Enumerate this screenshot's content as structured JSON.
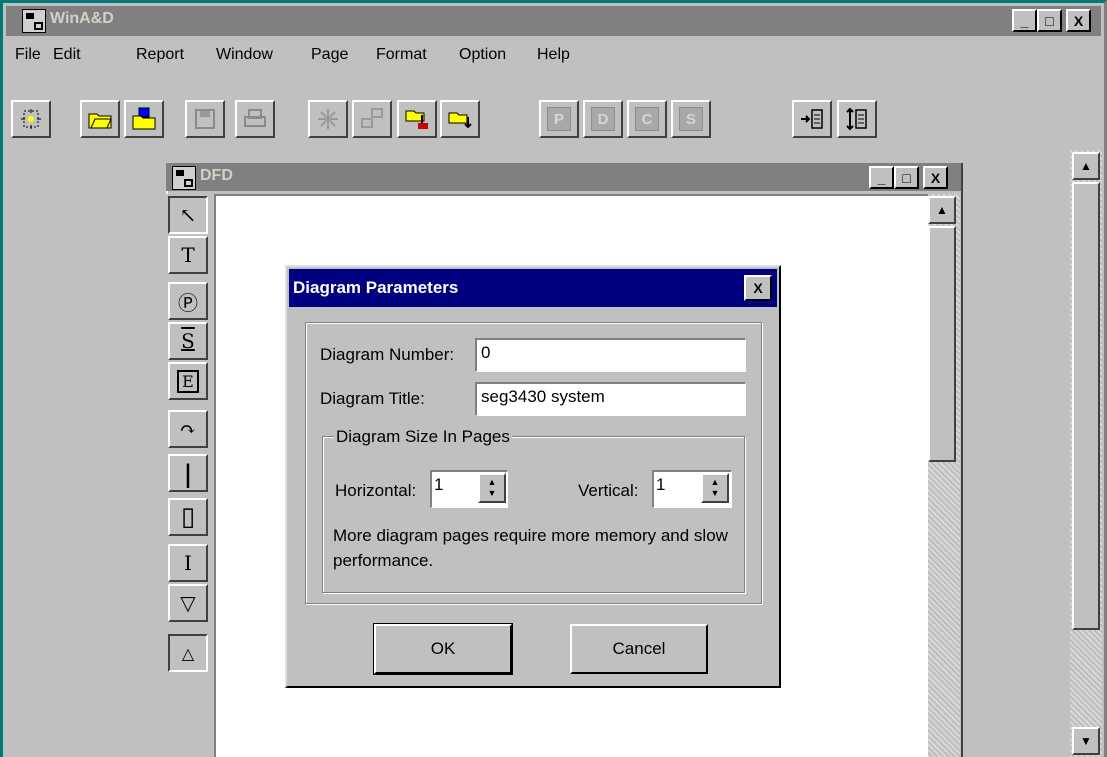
{
  "app": {
    "title": "WinA&D",
    "window_controls": {
      "minimize": "_",
      "maximize": "□",
      "close": "X"
    }
  },
  "menu": [
    {
      "label": "File"
    },
    {
      "label": "Edit"
    },
    {
      "label": "Report"
    },
    {
      "label": "Window"
    },
    {
      "label": "Page"
    },
    {
      "label": "Format"
    },
    {
      "label": "Option"
    },
    {
      "label": "Help"
    }
  ],
  "toolbar": {
    "letter_buttons": [
      "P",
      "D",
      "C",
      "S"
    ]
  },
  "child_window": {
    "title": "DFD",
    "window_controls": {
      "minimize": "_",
      "maximize": "□",
      "close": "X"
    }
  },
  "palette": [
    {
      "name": "pointer-tool-icon",
      "glyph": "↖"
    },
    {
      "name": "text-tool-icon",
      "glyph": "T"
    },
    {
      "name": "process-tool-icon",
      "glyph": "Ⓟ"
    },
    {
      "name": "store-tool-icon",
      "glyph": "S"
    },
    {
      "name": "external-entity-tool-icon",
      "glyph": "E"
    },
    {
      "name": "dataflow-tool-icon",
      "glyph": "↷"
    },
    {
      "name": "line-tool-icon",
      "glyph": "|"
    },
    {
      "name": "page-tool-icon",
      "glyph": "▯"
    },
    {
      "name": "ibeam-tool-icon",
      "glyph": "I"
    },
    {
      "name": "triangle-tool-icon",
      "glyph": "▽"
    },
    {
      "name": "shapes-tool-icon",
      "glyph": "△"
    }
  ],
  "dialog": {
    "title": "Diagram Parameters",
    "close_label": "X",
    "diagram_number_label": "Diagram Number:",
    "diagram_number_value": "0",
    "diagram_title_label": "Diagram Title:",
    "diagram_title_value": "seg3430 system",
    "group_label": "Diagram Size In Pages",
    "horizontal_label": "Horizontal:",
    "horizontal_value": "1",
    "vertical_label": "Vertical:",
    "vertical_value": "1",
    "note": "More diagram pages require more memory and slow performance.",
    "ok_label": "OK",
    "cancel_label": "Cancel"
  },
  "colors": {
    "dialog_title_bg": "#000080",
    "inactive_title_bg": "#808080",
    "face": "#c0c0c0",
    "frame_accent": "#00797a"
  }
}
